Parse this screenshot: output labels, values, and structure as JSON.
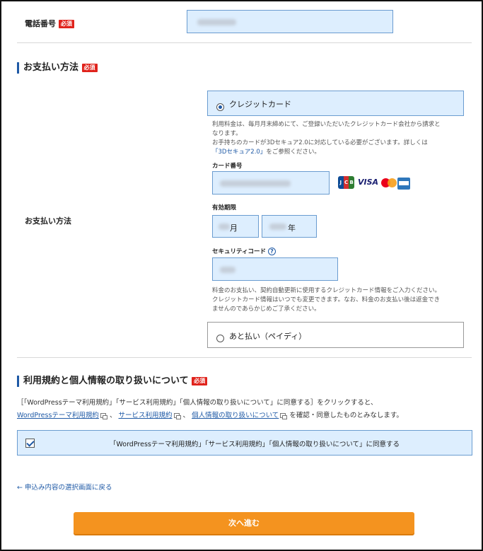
{
  "phone": {
    "label": "電話番号",
    "required": "必須"
  },
  "payment_section": {
    "title": "お支払い方法",
    "required": "必須"
  },
  "payment_row_label": "お支払い方法",
  "credit": {
    "option_label": "クレジットカード",
    "note_line1": "利用料金は、毎月月末締めにて、ご登録いただいたクレジットカード会社から請求と",
    "note_line2": "なります。",
    "note_line3": "お手持ちのカードが3Dセキュア2.0に対応している必要がございます。詳しくは",
    "note_link": "「3Dセキュア2.0」",
    "note_line4_tail": "をご参照ください。",
    "card_number_label": "カード番号",
    "brands": [
      "JCB",
      "VISA",
      "MasterCard",
      "AMEX"
    ],
    "expiry_label": "有効期限",
    "month_suffix": "月",
    "year_suffix": "年",
    "security_label": "セキュリティコード",
    "help_glyph": "?",
    "note2_line1": "料金のお支払い、契約自動更新に使用するクレジットカード情報をご入力ください。",
    "note2_line2": "クレジットカード情報はいつでも変更できます。なお、料金のお支払い後は返金でき",
    "note2_line3": "ませんのであらかじめご了承ください。"
  },
  "deferred": {
    "option_label": "あと払い（ペイディ）"
  },
  "terms": {
    "title": "利用規約と個人情報の取り扱いについて",
    "required": "必須",
    "text1": "［「WordPressテーマ利用規約」「サービス利用規約」「個人情報の取り扱いについて」に同意する］をクリックすると、",
    "link1": "WordPressテーマ利用規約",
    "sep1": "、",
    "link2": "サービス利用規約",
    "sep2": "、",
    "link3": "個人情報の取り扱いについて",
    "tail": "を確認・同意したものとみなします。",
    "agree_label": "「WordPressテーマ利用規約」「サービス利用規約」「個人情報の取り扱いについて」に同意する"
  },
  "back_link": "← 申込み内容の選択画面に戻る",
  "next_button": "次へ進む",
  "colors": {
    "accent": "#1f5aa6",
    "required": "#e0231c",
    "field_bg": "#ddeefe",
    "button": "#f4931f"
  }
}
